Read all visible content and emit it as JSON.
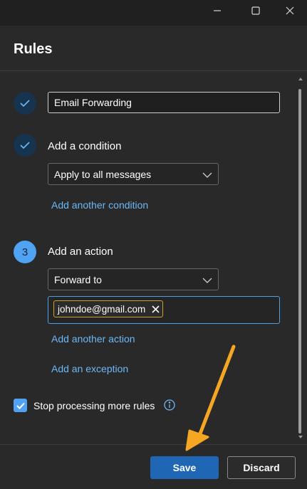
{
  "window": {
    "controls": [
      "minimize-icon",
      "maximize-icon",
      "close-icon"
    ]
  },
  "header": {
    "title": "Rules"
  },
  "rule": {
    "name_value": "Email Forwarding",
    "condition": {
      "heading": "Add a condition",
      "selected": "Apply to all messages",
      "add_link": "Add another condition"
    },
    "action": {
      "step_number": "3",
      "heading": "Add an action",
      "selected": "Forward to",
      "recipients": [
        "johndoe@gmail.com"
      ],
      "add_link": "Add another action"
    },
    "exception_link": "Add an exception",
    "stop_processing": {
      "label": "Stop processing more rules",
      "checked": true
    }
  },
  "footer": {
    "save_label": "Save",
    "discard_label": "Discard"
  },
  "colors": {
    "accent": "#4fa3f2",
    "link": "#6cb8f6",
    "primary_button": "#1f67b5",
    "annotation_arrow": "#f5a623",
    "chip_border": "#c9a227"
  }
}
